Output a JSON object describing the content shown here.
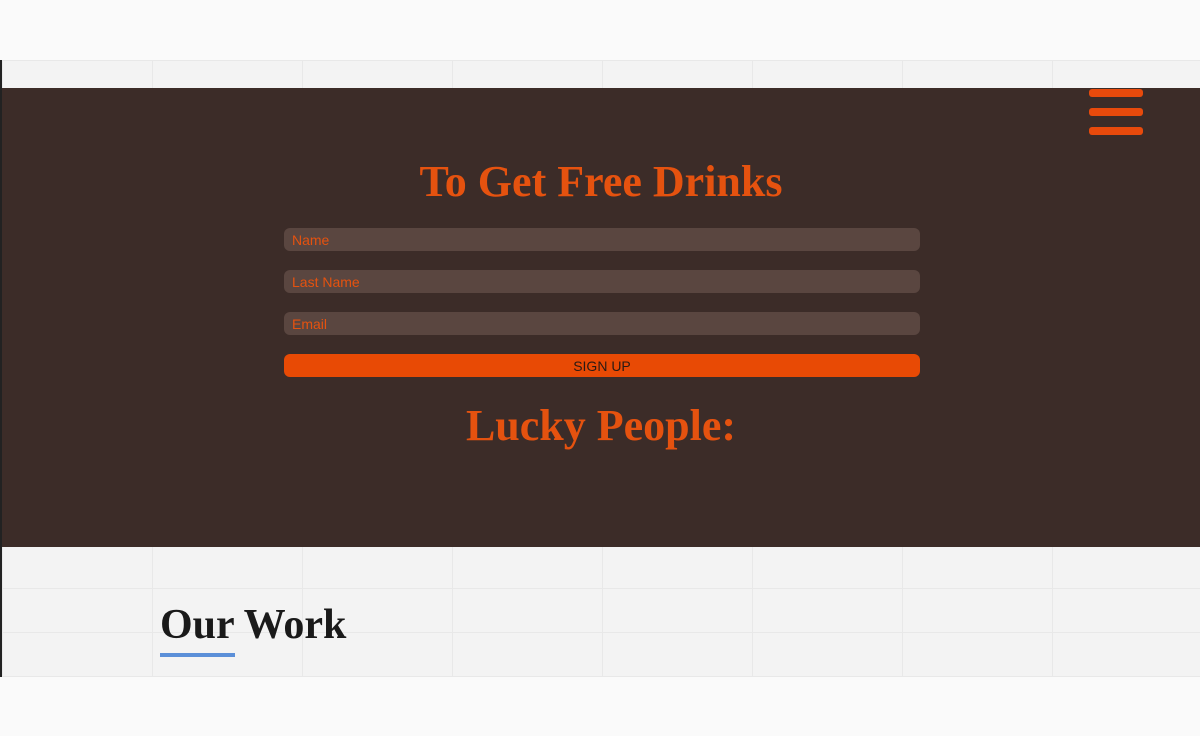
{
  "colors": {
    "panel_background": "#3c2c28",
    "accent": "#e5520f",
    "field_background": "#5a4640",
    "button_background": "#e84a05",
    "underline": "#5b8fd8"
  },
  "menu": {
    "icon": "hamburger-menu-icon"
  },
  "signup": {
    "title": "To Get Free Drinks",
    "name_placeholder": "Name",
    "last_name_placeholder": "Last Name",
    "email_placeholder": "Email",
    "button_label": "SIGN UP"
  },
  "lucky": {
    "title": "Lucky People:"
  },
  "work_section": {
    "title": "Our Work"
  }
}
